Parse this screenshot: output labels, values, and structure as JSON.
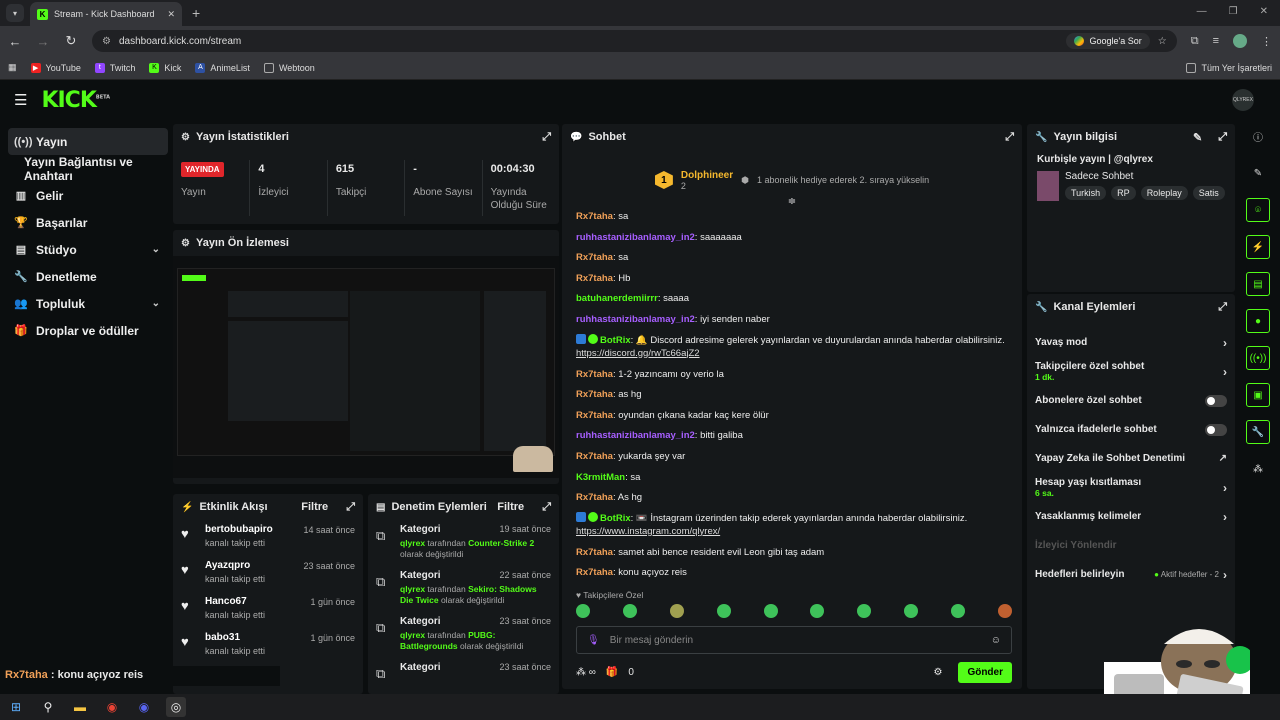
{
  "browser": {
    "tab_title": "Stream - Kick Dashboard",
    "url": "dashboard.kick.com/stream",
    "google_btn": "Google'a Sor",
    "bookmarks": [
      "YouTube",
      "Twitch",
      "Kick",
      "AnimeList",
      "Webtoon"
    ],
    "all_bookmarks": "Tüm Yer İşaretleri"
  },
  "app": {
    "logo": "KICK",
    "logo_sup": "BETA",
    "avatar_text": "QLYREX"
  },
  "sidebar": {
    "items": [
      {
        "label": "Yayın",
        "icon": "broadcast-icon"
      },
      {
        "label": "Yayın Bağlantısı ve Anahtarı",
        "icon": ""
      },
      {
        "label": "Gelir",
        "icon": "chart-icon"
      },
      {
        "label": "Başarılar",
        "icon": "trophy-icon"
      },
      {
        "label": "Stüdyo",
        "icon": "studio-icon"
      },
      {
        "label": "Denetleme",
        "icon": "wrench-icon"
      },
      {
        "label": "Topluluk",
        "icon": "community-icon"
      },
      {
        "label": "Droplar ve ödüller",
        "icon": "drops-icon"
      }
    ]
  },
  "stats": {
    "title": "Yayın İstatistikleri",
    "live_badge": "YAYINDA",
    "items": [
      {
        "value": "",
        "label": "Yayın"
      },
      {
        "value": "4",
        "label": "İzleyici"
      },
      {
        "value": "615",
        "label": "Takipçi"
      },
      {
        "value": "-",
        "label": "Abone Sayısı"
      },
      {
        "value": "00:04:30",
        "label": "Yayında Olduğu Süre"
      }
    ]
  },
  "preview": {
    "title": "Yayın Ön İzlemesi"
  },
  "activity": {
    "title": "Etkinlik Akışı",
    "filter": "Filtre",
    "items": [
      {
        "name": "bertobubapiro",
        "sub": "kanalı takip etti",
        "time": "14 saat önce"
      },
      {
        "name": "Ayazqpro",
        "sub": "kanalı takip etti",
        "time": "23 saat önce"
      },
      {
        "name": "Hanco67",
        "sub": "kanalı takip etti",
        "time": "1 gün önce"
      },
      {
        "name": "babo31",
        "sub": "kanalı takip etti",
        "time": "1 gün önce"
      }
    ]
  },
  "moderation": {
    "title": "Denetim Eylemleri",
    "filter": "Filtre",
    "items": [
      {
        "cat": "Kategori",
        "time": "19 saat önce",
        "user": "qlyrex",
        "mid": "tarafından",
        "game": "Counter-Strike 2",
        "end": "olarak değiştirildi"
      },
      {
        "cat": "Kategori",
        "time": "22 saat önce",
        "user": "qlyrex",
        "mid": "tarafından",
        "game": "Sekiro: Shadows Die Twice",
        "end": "olarak değiştirildi"
      },
      {
        "cat": "Kategori",
        "time": "23 saat önce",
        "user": "qlyrex",
        "mid": "tarafından",
        "game": "PUBG: Battlegrounds",
        "end": "olarak değiştirildi"
      },
      {
        "cat": "Kategori",
        "time": "23 saat önce",
        "user": "",
        "mid": "",
        "game": "",
        "end": ""
      }
    ]
  },
  "chat": {
    "title": "Sohbet",
    "pinned_name": "Dolphineer",
    "pinned_count": "2",
    "pinned_rank": "1",
    "pinned_text": "1 abonelik hediye ederek 2. sıraya yükselin",
    "messages": [
      {
        "user": "Rx7taha",
        "color": "u-or",
        "text": "sa"
      },
      {
        "user": "ruhhastanizibanlamay_in2",
        "color": "u-pu",
        "text": "saaaaaaa"
      },
      {
        "user": "Rx7taha",
        "color": "u-or",
        "text": "sa"
      },
      {
        "user": "Rx7taha",
        "color": "u-or",
        "text": "Hb"
      },
      {
        "user": "batuhanerdemiirrr",
        "color": "u-gr",
        "text": "saaaa"
      },
      {
        "user": "ruhhastanizibanlamay_in2",
        "color": "u-pu",
        "text": "iyi senden naber"
      },
      {
        "user": "BotRix",
        "color": "u-gr",
        "bot": true,
        "text": "🔔 Discord adresime gelerek yayınlardan ve duyurulardan anında haberdar olabilirsiniz.",
        "link": "https://discord.gg/rwTc66ajZ2"
      },
      {
        "user": "Rx7taha",
        "color": "u-or",
        "text": "1-2 yazıncamı oy verio la"
      },
      {
        "user": "Rx7taha",
        "color": "u-or",
        "text": "as hg"
      },
      {
        "user": "Rx7taha",
        "color": "u-or",
        "text": "oyundan çıkana kadar kaç kere ölür"
      },
      {
        "user": "ruhhastanizibanlamay_in2",
        "color": "u-pu",
        "text": "bitti galiba"
      },
      {
        "user": "Rx7taha",
        "color": "u-or",
        "text": "yukarda şey var"
      },
      {
        "user": "K3rmitMan",
        "color": "u-gr",
        "text": "sa"
      },
      {
        "user": "Rx7taha",
        "color": "u-or",
        "text": "As hg"
      },
      {
        "user": "BotRix",
        "color": "u-gr",
        "bot": true,
        "text": "📼 İnstagram üzerinden takip ederek yayınlardan anında haberdar olabilirsiniz.",
        "link": "https://www.instagram.com/qlyrex/"
      },
      {
        "user": "Rx7taha",
        "color": "u-or",
        "text": "samet abi bence resident evil Leon gibi taş adam"
      },
      {
        "user": "Rx7taha",
        "color": "u-or",
        "text": "konu açıyoz reis"
      }
    ],
    "followers_only": "Takipçilere Özel",
    "placeholder": "Bir mesaj gönderin",
    "points": "0",
    "send": "Gönder"
  },
  "streaminfo": {
    "title": "Yayın bilgisi",
    "stream_title": "Kurbişle yayın | @qlyrex",
    "category": "Sadece Sohbet",
    "tags": [
      "Turkish",
      "RP",
      "Roleplay",
      "Satis"
    ]
  },
  "actions": {
    "title": "Kanal Eylemleri",
    "items": [
      {
        "label": "Yavaş mod",
        "sub": "",
        "kind": "arrow"
      },
      {
        "label": "Takipçilere özel sohbet",
        "sub": "1 dk.",
        "kind": "arrow"
      },
      {
        "label": "Abonelere özel sohbet",
        "sub": "",
        "kind": "toggle"
      },
      {
        "label": "Yalnızca ifadelerle sohbet",
        "sub": "",
        "kind": "toggle"
      },
      {
        "label": "Yapay Zeka ile Sohbet Denetimi",
        "sub": "",
        "kind": "ext"
      },
      {
        "label": "Hesap yaşı kısıtlaması",
        "sub": "6 sa.",
        "kind": "arrow"
      },
      {
        "label": "Yasaklanmış kelimeler",
        "sub": "",
        "kind": "arrow"
      },
      {
        "label": "İzleyici Yönlendir",
        "sub": "",
        "kind": "disabled"
      },
      {
        "label": "Hedefleri belirleyin",
        "sub": "",
        "kind": "goals",
        "extra": "Aktif hedefler - 2"
      }
    ]
  },
  "overlay": {
    "user": "Rx7taha",
    "text": " : konu açıyoz reis"
  }
}
